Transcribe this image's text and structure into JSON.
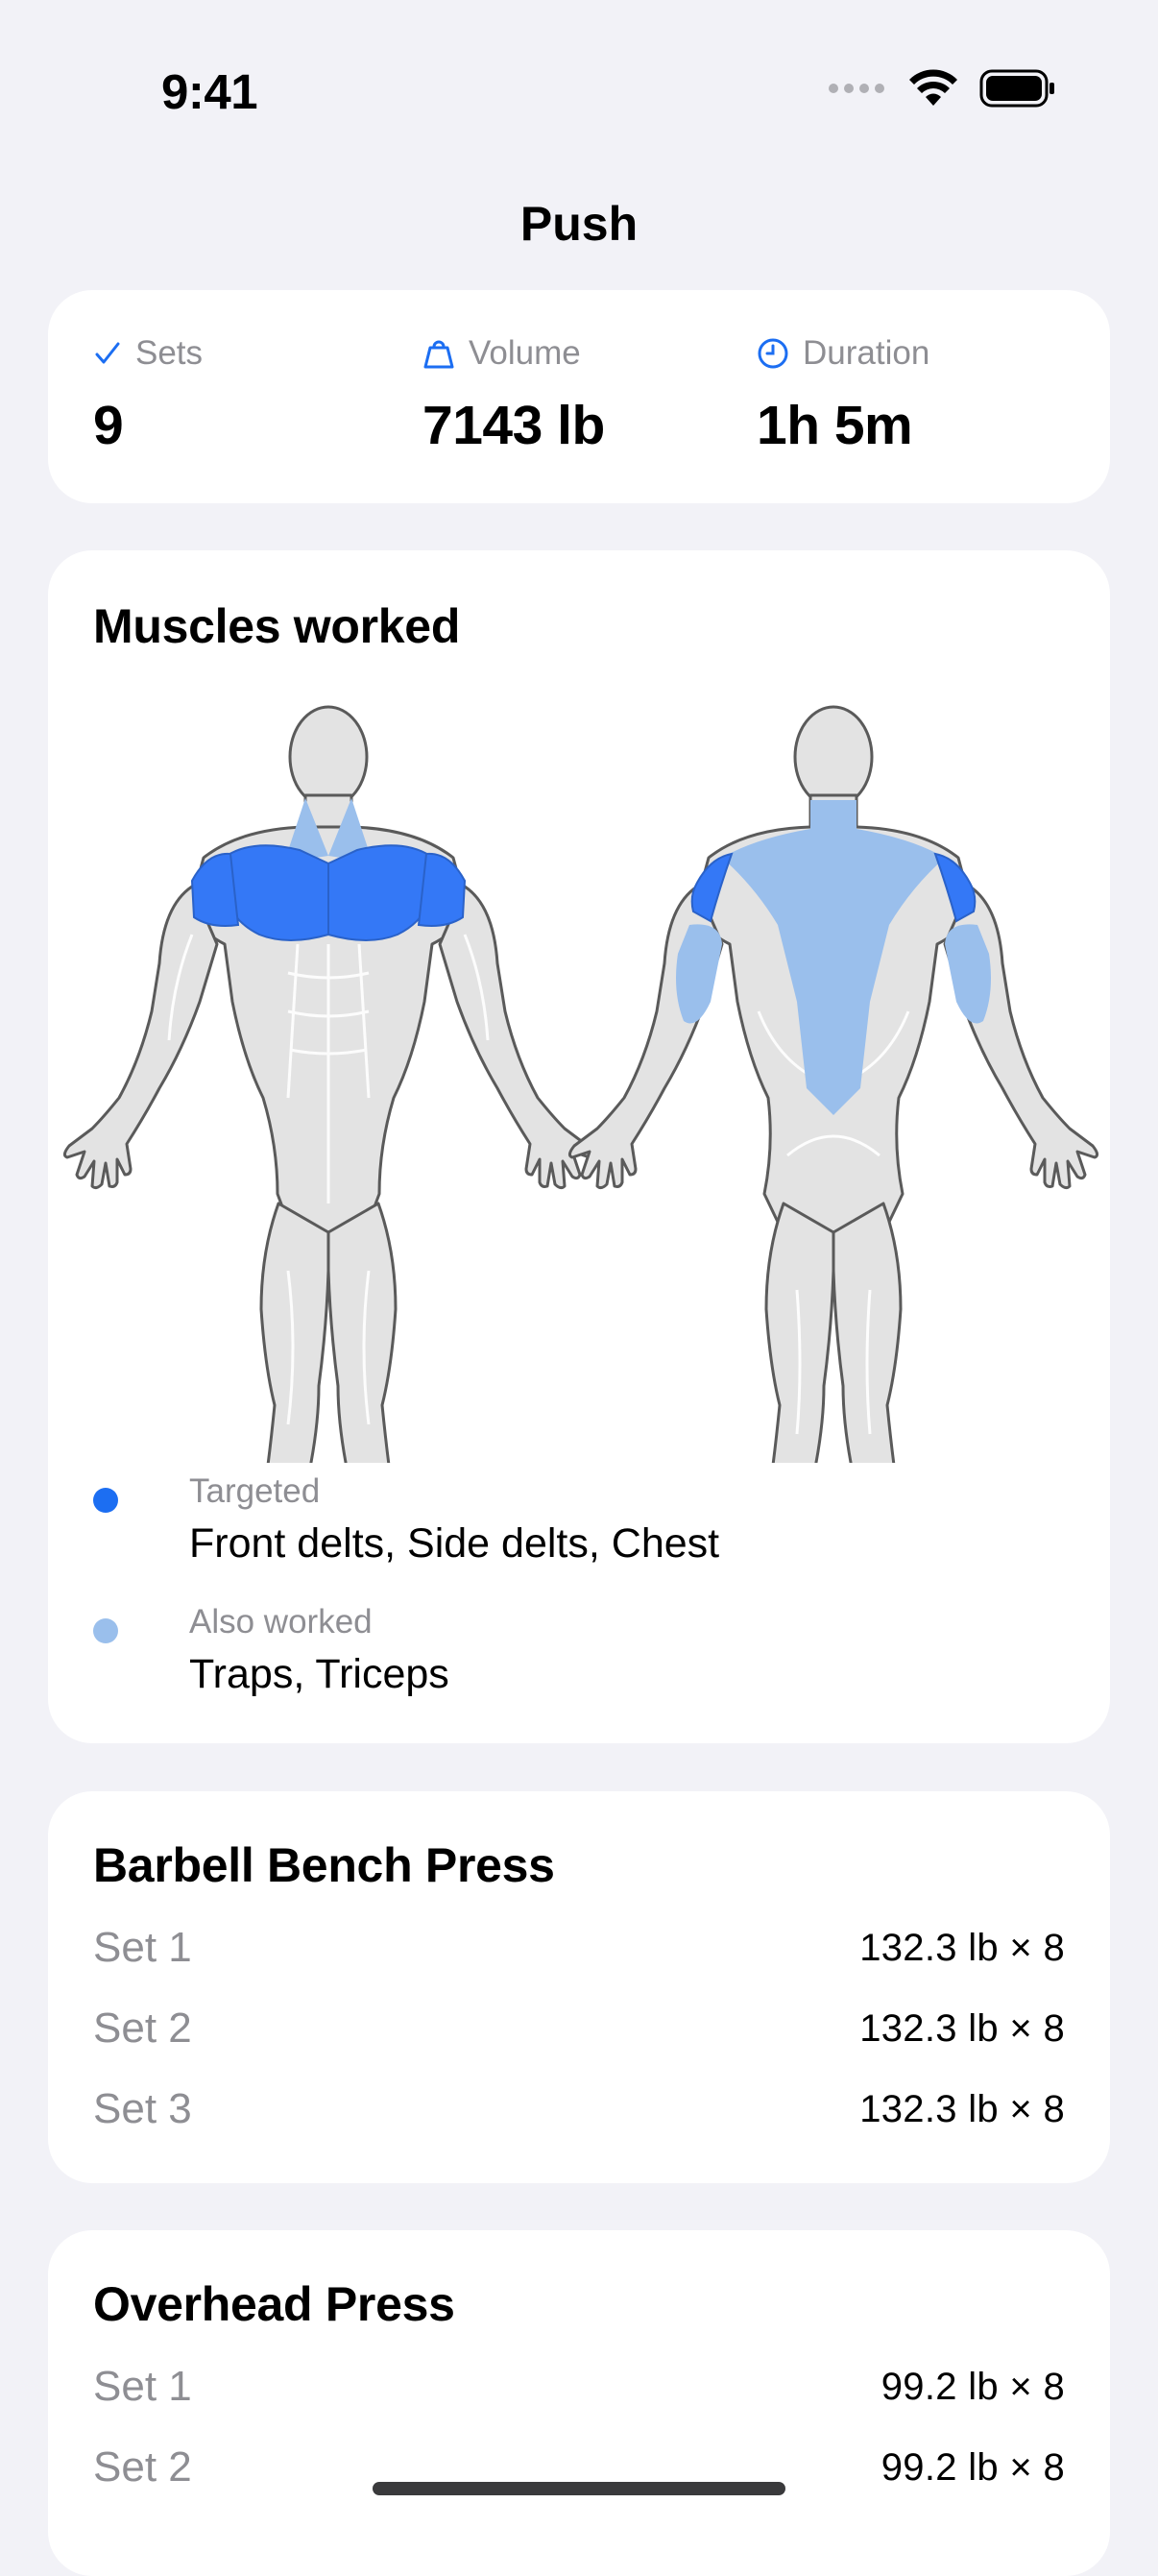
{
  "status_bar": {
    "time": "9:41"
  },
  "nav": {
    "title": "Push"
  },
  "stats": {
    "sets": {
      "label": "Sets",
      "value": "9",
      "icon": "checkmark-icon"
    },
    "volume": {
      "label": "Volume",
      "value": "7143 lb",
      "icon": "weight-icon"
    },
    "duration": {
      "label": "Duration",
      "value": "1h 5m",
      "icon": "clock-icon"
    }
  },
  "muscles": {
    "title": "Muscles worked",
    "targeted": {
      "label": "Targeted",
      "value": "Front delts, Side delts, Chest",
      "color": "#3478f6"
    },
    "also": {
      "label": "Also worked",
      "value": "Traps, Triceps",
      "color": "#9abfec"
    }
  },
  "exercises": [
    {
      "name": "Barbell Bench Press",
      "sets": [
        {
          "label": "Set 1",
          "value": "132.3 lb × 8"
        },
        {
          "label": "Set 2",
          "value": "132.3 lb × 8"
        },
        {
          "label": "Set 3",
          "value": "132.3 lb × 8"
        }
      ]
    },
    {
      "name": "Overhead Press",
      "sets": [
        {
          "label": "Set 1",
          "value": "99.2 lb × 8"
        },
        {
          "label": "Set 2",
          "value": "99.2 lb × 8"
        }
      ]
    }
  ],
  "colors": {
    "accent": "#1c6ef2",
    "background": "#f2f2f7"
  }
}
